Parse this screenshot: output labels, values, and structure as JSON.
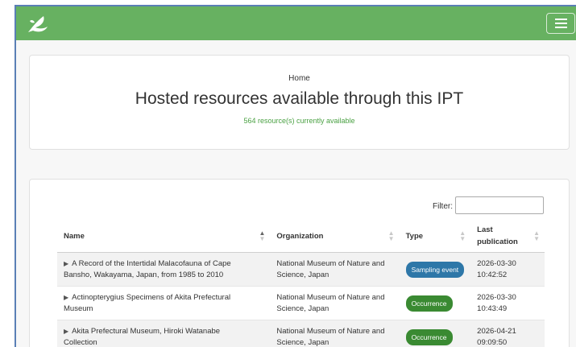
{
  "header": {
    "logo": "ipt-leaf-logo",
    "menu_icon": "hamburger-menu-icon",
    "brand_color": "#67b161"
  },
  "hero": {
    "breadcrumb": "Home",
    "title": "Hosted resources available through this IPT",
    "count": "564 resource(s) currently available"
  },
  "filter": {
    "label": "Filter:",
    "value": ""
  },
  "table": {
    "columns": [
      "Name",
      "Organization",
      "Type",
      "Last publication"
    ],
    "rows": [
      {
        "name_line1": "A Record of the Intertidal Malacofauna of Cape",
        "name_line2": "Bansho, Wakayama, Japan, from 1985 to 2010",
        "org_line1": "National Museum of Nature and",
        "org_line2": "Science, Japan",
        "type": "Sampling event",
        "type_color": "#2e77a8",
        "date": "2026-03-30",
        "time": "10:42:52"
      },
      {
        "name_line1": "Actinopterygius Specimens of Akita Prefectural",
        "name_line2": "Museum",
        "org_line1": "National Museum of Nature and",
        "org_line2": "Science, Japan",
        "type": "Occurrence",
        "type_color": "#3a8a32",
        "date": "2026-03-30",
        "time": "10:43:49"
      },
      {
        "name_line1": "Akita Prefectural Museum, Hiroki Watanabe",
        "name_line2": "Collection",
        "org_line1": "National Museum of Nature and",
        "org_line2": "Science, Japan",
        "type": "Occurrence",
        "type_color": "#3a8a32",
        "date": "2026-04-21",
        "time": "09:09:50"
      }
    ]
  }
}
